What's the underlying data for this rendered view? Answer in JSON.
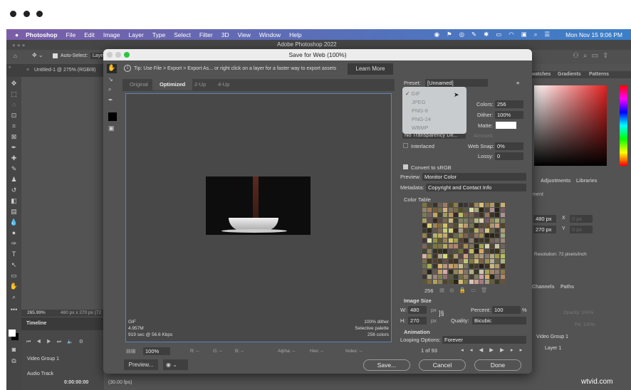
{
  "window_dots": [
    "close",
    "minimize",
    "zoom"
  ],
  "menubar": {
    "items": [
      "Photoshop",
      "File",
      "Edit",
      "Image",
      "Layer",
      "Type",
      "Select",
      "Filter",
      "3D",
      "View",
      "Window",
      "Help"
    ],
    "clock": "Mon Nov 15  9:06 PM"
  },
  "ps": {
    "title": "Adobe Photoshop 2022",
    "auto_select": "Auto-Select:",
    "layer_dd": "Layer",
    "doc_tab": "Untitled-1 @ 275% (RGB/8)",
    "zoom_status": "265.99%",
    "doc_size": "480 px x 270 px (72",
    "panels": {
      "tabs_top": [
        "Swatches",
        "Gradients",
        "Patterns"
      ],
      "tabs_mid": [
        "Adjustments",
        "Libraries"
      ],
      "properties_hint": "Document",
      "w": "480 px",
      "h": "270 px",
      "x": "0 px",
      "y": "0 px",
      "x_label": "X",
      "y_label": "Y",
      "resolution": "Resolution: 72 pixels/inch",
      "tabs_bottom": [
        "Channels",
        "Paths"
      ],
      "opacity": "Opacity: 100%",
      "fill": "Fill: 100%",
      "layers": [
        "Video Group 1",
        "Layer 1"
      ]
    },
    "timeline": {
      "title": "Timeline",
      "group": "Video Group 1",
      "audio": "Audio Track",
      "timecode": "0:00:00:00",
      "fps": "(30.00 fps)"
    }
  },
  "dialog": {
    "title": "Save for Web (100%)",
    "tip": "Tip: Use File > Export > Export As...  or right click on a layer for a faster way to export assets",
    "learn_more": "Learn More",
    "tabs": [
      "Original",
      "Optimized",
      "2-Up",
      "4-Up"
    ],
    "active_tab": "Optimized",
    "info_left": [
      "GIF",
      "4.957M",
      "919 sec @ 56.6 Kbps"
    ],
    "info_right": [
      "100% dither",
      "Selective palette",
      "256 colors"
    ],
    "zoom": "100%",
    "readouts": [
      "R: --",
      "G: --",
      "B: --",
      "Alpha: --",
      "Hex: --",
      "Index: --"
    ],
    "preview_btn": "Preview...",
    "save": "Save...",
    "cancel": "Cancel",
    "done": "Done",
    "settings": {
      "preset_label": "Preset:",
      "preset": "[Unnamed]",
      "format_options": [
        "GIF",
        "JPEG",
        "PNG-8",
        "PNG-24",
        "WBMP"
      ],
      "selected_format": "GIF",
      "colors_label": "Colors:",
      "colors": "256",
      "dither_label": "Dither:",
      "dither": "100%",
      "matte_label": "Matte:",
      "transparency": "No Transparency Dit...",
      "amount_label": "Amount:",
      "interlaced": "Interlaced",
      "websnap_label": "Web Snap:",
      "websnap": "0%",
      "lossy_label": "Lossy:",
      "lossy": "0",
      "convert_srgb": "Convert to sRGB",
      "preview_label": "Preview:",
      "preview": "Monitor Color",
      "metadata_label": "Metadata:",
      "metadata": "Copyright and Contact Info",
      "color_table": "Color Table",
      "color_count": "256",
      "image_size": "Image Size",
      "w_label": "W:",
      "w": "480",
      "h_label": "H:",
      "h": "270",
      "px": "px",
      "percent_label": "Percent:",
      "percent": "100",
      "pct": "%",
      "quality_label": "Quality:",
      "quality": "Bicubic",
      "animation": "Animation",
      "looping_label": "Looping Options:",
      "looping": "Forever",
      "frame": "1 of 93"
    }
  },
  "watermark": "wtvid.com"
}
